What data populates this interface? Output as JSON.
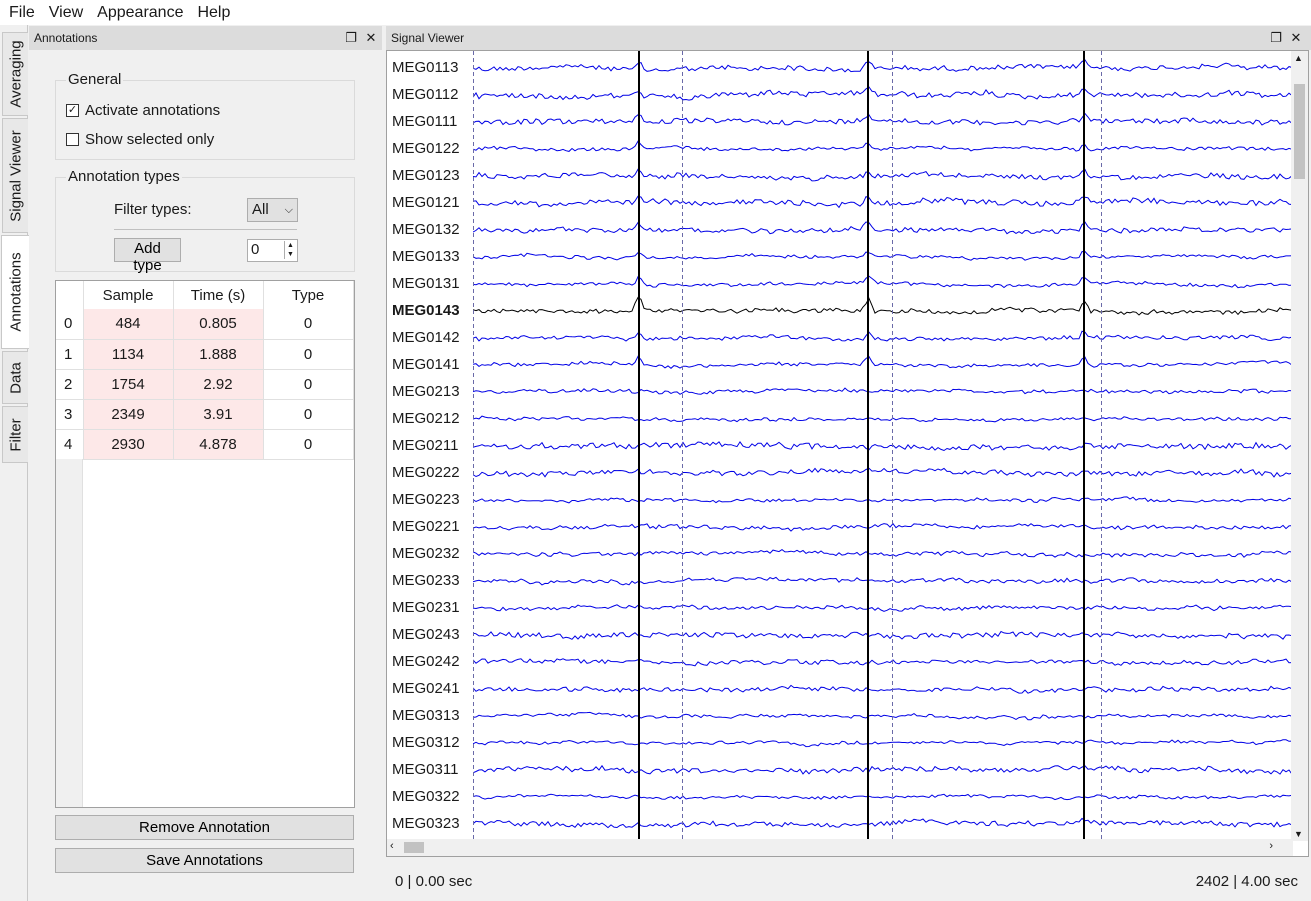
{
  "menu": [
    "File",
    "View",
    "Appearance",
    "Help"
  ],
  "side_tabs": [
    "Averaging",
    "Signal Viewer",
    "Annotations",
    "Data",
    "Filter"
  ],
  "annotations_dock": {
    "title": "Annotations",
    "general": {
      "title": "General",
      "activate_label": "Activate annotations",
      "activate_checked": true,
      "selected_only_label": "Show selected only",
      "selected_only_checked": false
    },
    "types": {
      "title": "Annotation types",
      "filter_label": "Filter types:",
      "filter_value": "All",
      "add_type_label": "Add type",
      "spin_value": "0"
    },
    "table": {
      "headers": [
        "Sample",
        "Time (s)",
        "Type"
      ],
      "rows": [
        {
          "index": "0",
          "sample": "484",
          "time": "0.805",
          "type": "0"
        },
        {
          "index": "1",
          "sample": "1134",
          "time": "1.888",
          "type": "0"
        },
        {
          "index": "2",
          "sample": "1754",
          "time": "2.92",
          "type": "0"
        },
        {
          "index": "3",
          "sample": "2349",
          "time": "3.91",
          "type": "0"
        },
        {
          "index": "4",
          "sample": "2930",
          "time": "4.878",
          "type": "0"
        }
      ]
    },
    "remove_label": "Remove Annotation",
    "save_label": "Save Annotations"
  },
  "signal_viewer": {
    "title": "Signal Viewer",
    "channels": [
      "MEG0113",
      "MEG0112",
      "MEG0111",
      "MEG0122",
      "MEG0123",
      "MEG0121",
      "MEG0132",
      "MEG0133",
      "MEG0131",
      "MEG0143",
      "MEG0142",
      "MEG0141",
      "MEG0213",
      "MEG0212",
      "MEG0211",
      "MEG0222",
      "MEG0223",
      "MEG0221",
      "MEG0232",
      "MEG0233",
      "MEG0231",
      "MEG0243",
      "MEG0242",
      "MEG0241",
      "MEG0313",
      "MEG0312",
      "MEG0311",
      "MEG0322",
      "MEG0323"
    ],
    "selected_channel": "MEG0143",
    "trace_color": "#0000e6",
    "selected_color": "#000000",
    "status_left": "0 | 0.00 sec",
    "status_right": "2402 | 4.00 sec"
  }
}
